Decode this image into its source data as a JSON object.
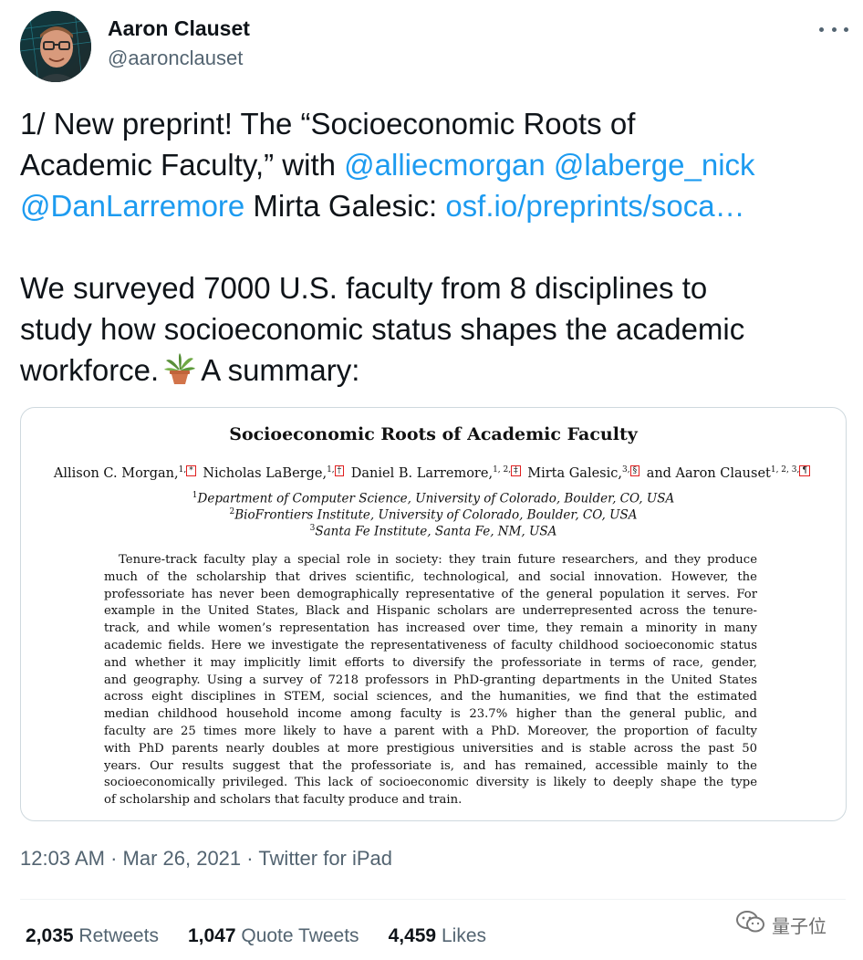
{
  "author": {
    "name": "Aaron Clauset",
    "handle": "@aaronclauset"
  },
  "tweet": {
    "line1": "1/ New preprint! The “Socioeconomic Roots of",
    "line2_text": "Academic Faculty,” with ",
    "mention1": "@alliecmorgan",
    "mention2": "@laberge_nick",
    "mention3": "@DanLarremore",
    "line3_text": " Mirta Galesic: ",
    "link": "osf.io/preprints/soca…",
    "line4": "We surveyed 7000 U.S. faculty from 8 disciplines to",
    "line5": "study how socioeconomic status shapes the academic",
    "line6a": "workforce.",
    "line6b": "A summary:"
  },
  "paper": {
    "title": "Socioeconomic Roots of Academic Faculty",
    "authors": [
      {
        "name": "Allison C. Morgan,",
        "sup": "1,",
        "mark": "*"
      },
      {
        "name": "Nicholas LaBerge,",
        "sup": "1,",
        "mark": "†"
      },
      {
        "name": "Daniel B. Larremore,",
        "sup": "1, 2,",
        "mark": "‡"
      },
      {
        "name": "Mirta Galesic,",
        "sup": "3,",
        "mark": "§"
      },
      {
        "name": "and Aaron Clauset",
        "sup": "1, 2, 3,",
        "mark": "¶"
      }
    ],
    "affiliations": [
      {
        "num": "1",
        "text": "Department of Computer Science, University of Colorado, Boulder, CO, USA"
      },
      {
        "num": "2",
        "text": "BioFrontiers Institute, University of Colorado, Boulder, CO, USA"
      },
      {
        "num": "3",
        "text": "Santa Fe Institute, Santa Fe, NM, USA"
      }
    ],
    "abstract_lines": [
      "Tenure-track faculty play a special role in society: they train future researchers, and they produce",
      "much of the scholarship that drives scientific, technological, and social innovation. However, the",
      "professoriate has never been demographically representative of the general population it serves. For",
      "example in the United States, Black and Hispanic scholars are underrepresented across the tenure-",
      "track, and while women’s representation has increased over time, they remain a minority in many",
      "academic fields. Here we investigate the representativeness of faculty childhood socioeconomic status",
      "and whether it may implicitly limit efforts to diversify the professoriate in terms of race, gender,",
      "and geography. Using a survey of 7218 professors in PhD-granting departments in the United States",
      "across eight disciplines in STEM, social sciences, and the humanities, we find that the estimated",
      "median childhood household income among faculty is 23.7% higher than the general public, and",
      "faculty are 25 times more likely to have a parent with a PhD. Moreover, the proportion of faculty",
      "with PhD parents nearly doubles at more prestigious universities and is stable across the past 50",
      "years. Our results suggest that the professoriate is, and has remained, accessible mainly to the",
      "socioeconomically privileged. This lack of socioeconomic diversity is likely to deeply shape the type",
      "of scholarship and scholars that faculty produce and train."
    ]
  },
  "meta": {
    "time": "12:03 AM",
    "date": "Mar 26, 2021",
    "source": "Twitter for iPad",
    "separator": " · "
  },
  "stats": {
    "retweets_num": "2,035",
    "retweets_label": "Retweets",
    "quotes_num": "1,047",
    "quotes_label": "Quote Tweets",
    "likes_num": "4,459",
    "likes_label": "Likes"
  },
  "watermark": {
    "text": "量子位"
  },
  "colors": {
    "link": "#1d9bf0",
    "secondary_text": "#536471",
    "primary_text": "#0f1419",
    "border": "#cfd9de"
  },
  "icons": {
    "more": "more-horizontal-icon",
    "plant": "potted-plant-emoji",
    "watermark": "wechat-icon"
  }
}
